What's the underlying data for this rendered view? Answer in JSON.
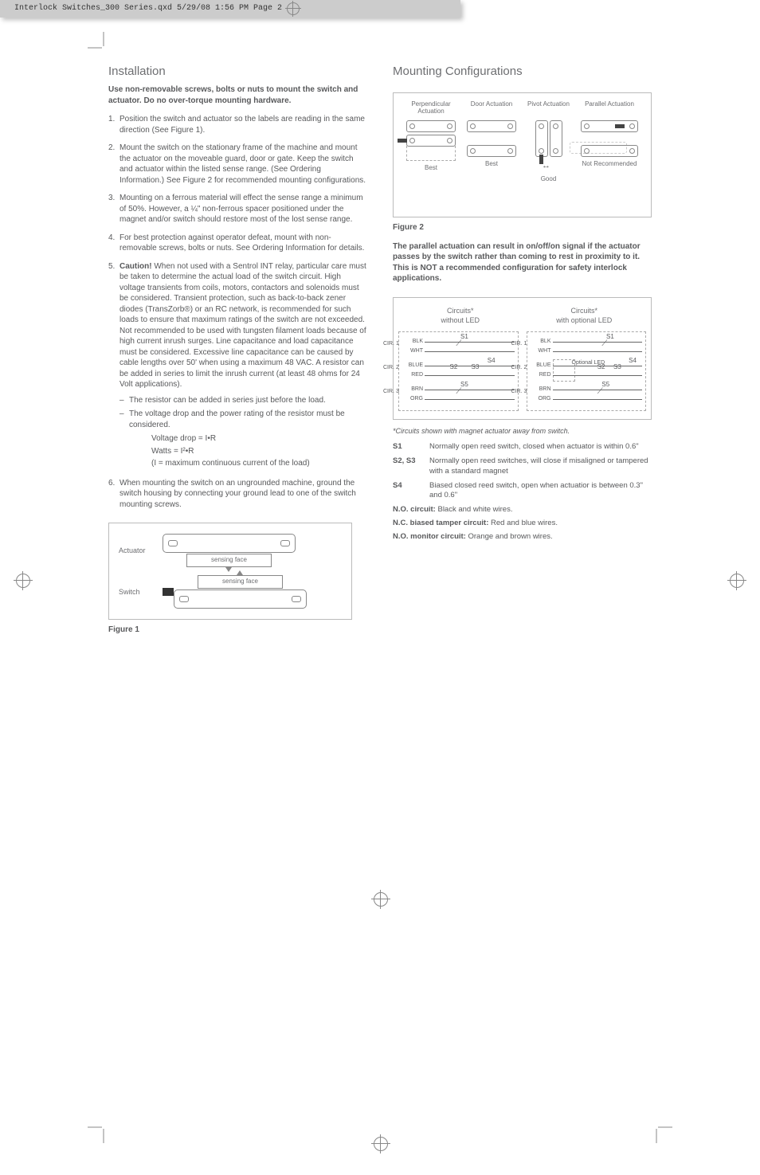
{
  "meta": {
    "file_tag": "Interlock Switches_300 Series.qxd  5/29/08  1:56 PM  Page 2"
  },
  "left": {
    "heading": "Installation",
    "intro": "Use non-removable screws, bolts or nuts to mount the switch and actuator. Do no over-torque mounting hardware.",
    "steps": [
      "Position the switch and actuator so the labels are reading in the same direction (See Figure 1).",
      "Mount the switch on the stationary frame of the machine and mount the actuator on the moveable guard, door or gate. Keep the switch and actuator within the listed sense range. (See Ordering Information.) See Figure 2 for recommended mounting configurations.",
      "Mounting on a ferrous material will effect the sense range a minimum of 50%. However, a ¼\" non-ferrous spacer positioned under the magnet and/or switch should restore most of the lost sense range.",
      "For best protection against operator defeat, mount with non-removable screws, bolts or nuts. See Ordering Information for details."
    ],
    "step5_lead": "Caution!",
    "step5_body": " When not used with a Sentrol INT relay, particular care must be taken to determine the actual load of the switch circuit. High voltage transients from coils, motors, contactors and solenoids must be considered. Transient protection, such as back-to-back zener diodes (TransZorb®) or an RC network, is recommended for such loads to ensure that maximum ratings of the switch are not exceeded. Not recommended to be used with tungsten filament loads because of high current inrush surges. Line capacitance and load capacitance must be considered. Excessive line capacitance can be caused by cable lengths over 50' when using a maximum 48 VAC. A resistor can be added in series to limit the inrush current (at least 48 ohms for 24 Volt applications).",
    "bullet1": "The resistor can be added in series just before the load.",
    "bullet2": "The voltage drop and the power rating of the resistor must be considered.",
    "eq1": "Voltage drop = I•R",
    "eq2": "Watts = I²•R",
    "eq3": "(I = maximum continuous current of the load)",
    "step6": "When mounting the switch on an ungrounded machine, ground the switch housing by connecting your ground lead to one of the switch mounting screws.",
    "fig1": {
      "actuator": "Actuator",
      "switch": "Switch",
      "sensing": "sensing face",
      "caption": "Figure 1"
    }
  },
  "right": {
    "heading": "Mounting Configurations",
    "fig2": {
      "h1": "Perpendicular Actuation",
      "h2": "Door Actuation",
      "h3": "Pivot Actuation",
      "h4": "Parallel Actuation",
      "b1": "Best",
      "b2": "Best",
      "b3": "Good",
      "b4": "Not Recommended",
      "caption": "Figure 2"
    },
    "para": "The parallel actuation can result in on/off/on signal if the actuator passes by the switch rather than coming to rest in proximity to it. This is NOT a recommended configuration for safety interlock applications.",
    "fig3": {
      "t1": "Circuits*\nwithout LED",
      "t2": "Circuits*\nwith optional LED",
      "opt_led": "Optional LED",
      "wires": {
        "blk": "BLK",
        "wht": "WHT",
        "blue": "BLUE",
        "red": "RED",
        "brn": "BRN",
        "org": "ORG"
      },
      "cir": {
        "c1": "CIR. 1",
        "c2": "CIR. 2",
        "c3": "CIR. 3"
      },
      "s": {
        "s1": "S1",
        "s2": "S2",
        "s3": "S3",
        "s4": "S4",
        "s5": "S5"
      }
    },
    "note": "*Circuits shown with magnet actuator away from switch.",
    "legend": [
      {
        "k": "S1",
        "v": "Normally open reed switch, closed when actuator is within 0.6\""
      },
      {
        "k": "S2, S3",
        "v": "Normally open reed switches, will close if misaligned or tampered with a standard magnet"
      },
      {
        "k": "S4",
        "v": "Biased closed reed switch, open when actuatior is between  0.3\" and 0.6\""
      }
    ],
    "lines": [
      {
        "k": "N.O. circuit:",
        "v": " Black and white wires."
      },
      {
        "k": "N.C. biased tamper circuit:",
        "v": " Red and blue wires."
      },
      {
        "k": "N.O. monitor circuit:",
        "v": " Orange and brown wires."
      }
    ]
  }
}
